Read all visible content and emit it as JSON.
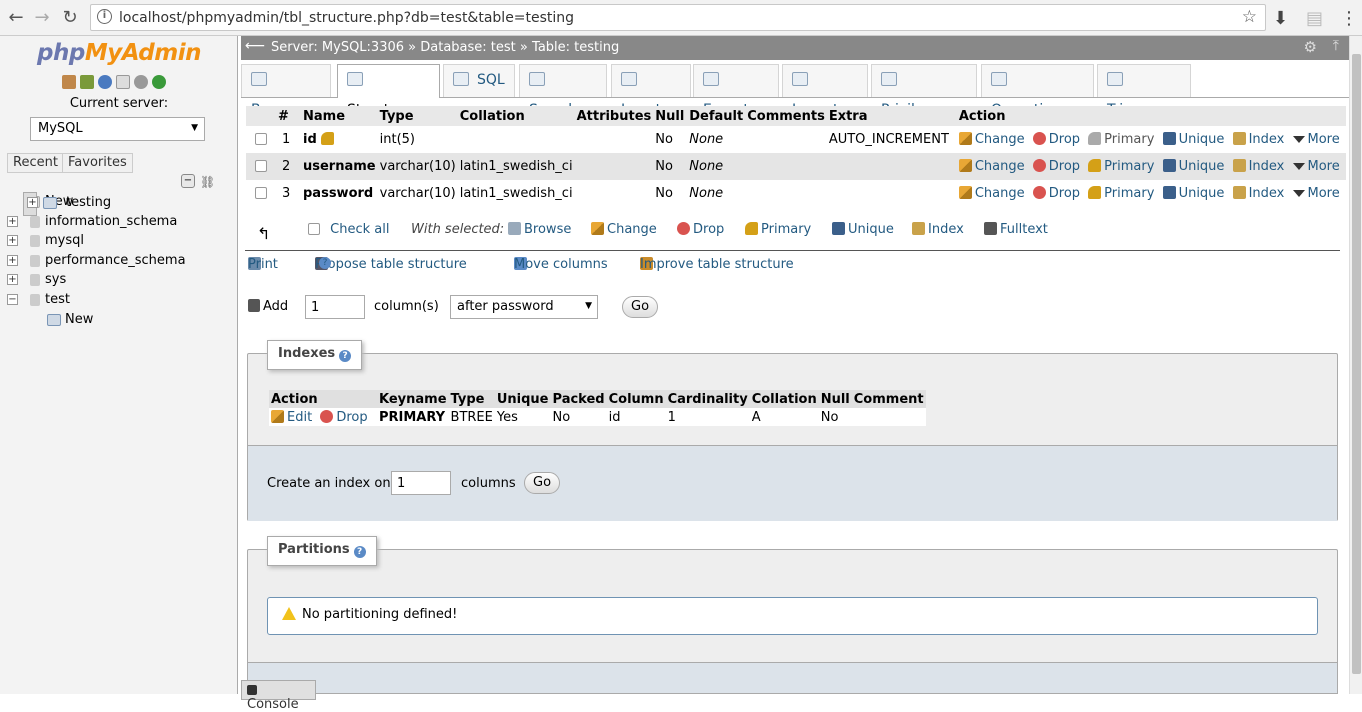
{
  "browser": {
    "url": "localhost/phpmyadmin/tbl_structure.php?db=test&table=testing",
    "back_icon": "back-arrow-icon",
    "forward_icon": "forward-arrow-icon",
    "reload_icon": "reload-icon"
  },
  "sidebar": {
    "logo_php": "php",
    "logo_my": "MyAdmin",
    "current_server_label": "Current server:",
    "server_value": "MySQL",
    "tab_recent": "Recent",
    "tab_favorites": "Favorites",
    "tree": [
      {
        "label": "New",
        "type": "new"
      },
      {
        "label": "information_schema",
        "type": "db"
      },
      {
        "label": "mysql",
        "type": "db"
      },
      {
        "label": "performance_schema",
        "type": "db"
      },
      {
        "label": "sys",
        "type": "db"
      },
      {
        "label": "test",
        "type": "db-open"
      },
      {
        "label": "New",
        "type": "table-new"
      },
      {
        "label": "testing",
        "type": "table"
      }
    ]
  },
  "breadcrumb": {
    "server": "Server: MySQL:3306",
    "database": "Database: test",
    "table": "Table: testing",
    "sep": "»"
  },
  "tabs": [
    {
      "label": "Browse"
    },
    {
      "label": "Structure"
    },
    {
      "label": "SQL"
    },
    {
      "label": "Search"
    },
    {
      "label": "Insert"
    },
    {
      "label": "Export"
    },
    {
      "label": "Import"
    },
    {
      "label": "Privileges"
    },
    {
      "label": "Operations"
    },
    {
      "label": "Triggers"
    }
  ],
  "structure": {
    "headers": [
      "#",
      "Name",
      "Type",
      "Collation",
      "Attributes",
      "Null",
      "Default",
      "Comments",
      "Extra",
      "Action"
    ],
    "rows": [
      {
        "num": "1",
        "name": "id",
        "type": "int(5)",
        "collation": "",
        "attributes": "",
        "null": "No",
        "default": "None",
        "comments": "",
        "extra": "AUTO_INCREMENT"
      },
      {
        "num": "2",
        "name": "username",
        "type": "varchar(10)",
        "collation": "latin1_swedish_ci",
        "attributes": "",
        "null": "No",
        "default": "None",
        "comments": "",
        "extra": ""
      },
      {
        "num": "3",
        "name": "password",
        "type": "varchar(10)",
        "collation": "latin1_swedish_ci",
        "attributes": "",
        "null": "No",
        "default": "None",
        "comments": "",
        "extra": ""
      }
    ],
    "actions": {
      "change": "Change",
      "drop": "Drop",
      "primary": "Primary",
      "unique": "Unique",
      "index": "Index",
      "more": "More"
    }
  },
  "with_selected": {
    "check_all": "Check all",
    "label": "With selected:",
    "browse": "Browse",
    "change": "Change",
    "drop": "Drop",
    "primary": "Primary",
    "unique": "Unique",
    "index": "Index",
    "fulltext": "Fulltext"
  },
  "tools": {
    "print": "Print",
    "propose": "Propose table structure",
    "move": "Move columns",
    "improve": "Improve table structure"
  },
  "add_column": {
    "add_label": "Add",
    "count": "1",
    "columns_label": "column(s)",
    "position": "after password",
    "go": "Go"
  },
  "indexes": {
    "legend": "Indexes",
    "headers": [
      "Action",
      "Keyname",
      "Type",
      "Unique",
      "Packed",
      "Column",
      "Cardinality",
      "Collation",
      "Null",
      "Comment"
    ],
    "row": {
      "edit": "Edit",
      "drop": "Drop",
      "keyname": "PRIMARY",
      "type": "BTREE",
      "unique": "Yes",
      "packed": "No",
      "column": "id",
      "cardinality": "1",
      "collation": "A",
      "null": "No",
      "comment": ""
    },
    "create_label": "Create an index on",
    "create_count": "1",
    "columns_label": "columns",
    "go": "Go"
  },
  "partitions": {
    "legend": "Partitions",
    "message": "No partitioning defined!"
  },
  "console": {
    "label": "Console"
  }
}
